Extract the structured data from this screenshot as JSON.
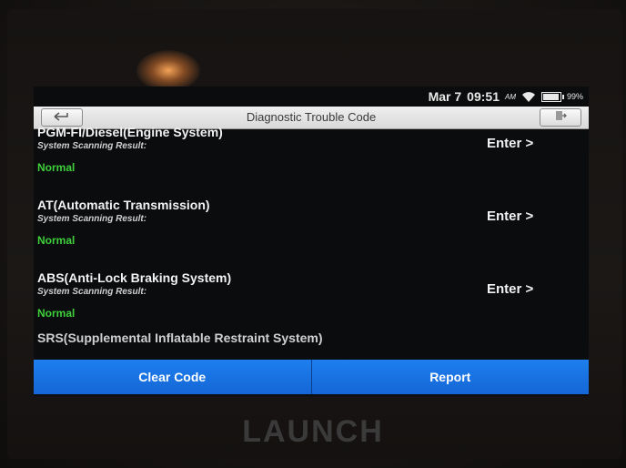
{
  "status_bar": {
    "date": "Mar 7",
    "time": "09:51",
    "ampm": "AM",
    "battery": "99%",
    "battery_level": 0.99
  },
  "header": {
    "title": "Diagnostic Trouble Code",
    "back_icon": "back-arrow-icon",
    "exit_icon": "exit-icon"
  },
  "systems": [
    {
      "name": "PGM-FI/Diesel(Engine System)",
      "scan_label": "System Scanning Result:",
      "result": "Normal",
      "enter": "Enter >"
    },
    {
      "name": "AT(Automatic Transmission)",
      "scan_label": "System Scanning Result:",
      "result": "Normal",
      "enter": "Enter >"
    },
    {
      "name": "ABS(Anti-Lock Braking System)",
      "scan_label": "System Scanning Result:",
      "result": "Normal",
      "enter": "Enter >"
    }
  ],
  "partial_system": {
    "name": "SRS(Supplemental Inflatable Restraint System)"
  },
  "bottom": {
    "clear_code": "Clear Code",
    "report": "Report"
  },
  "device_brand": "LAUNCH",
  "colors": {
    "accent_blue": "#1e7fee",
    "normal_green": "#3ecf3a",
    "screen_bg": "#0a0c0e"
  }
}
